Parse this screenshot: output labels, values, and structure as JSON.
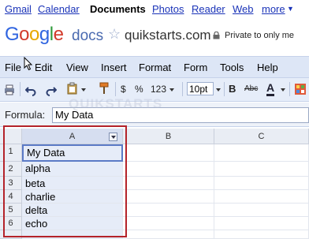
{
  "topnav": {
    "items": [
      "Gmail",
      "Calendar",
      "Documents",
      "Photos",
      "Reader",
      "Web",
      "more"
    ],
    "more_arrow": "▼"
  },
  "header": {
    "logo": "Google",
    "product": "docs",
    "domain": "quikstarts.com",
    "privacy": "Private to only me"
  },
  "menu": [
    "File",
    "Edit",
    "View",
    "Insert",
    "Format",
    "Form",
    "Tools",
    "Help"
  ],
  "toolbar": {
    "currency": "$",
    "percent": "%",
    "number_format": "123",
    "font_size": "10pt",
    "bold": "B",
    "strike": "Abc",
    "text_color": "A"
  },
  "formula": {
    "label": "Formula:",
    "value": "My Data"
  },
  "watermark": "QUIKSTARTS",
  "sheet": {
    "columns": [
      "A",
      "B",
      "C"
    ],
    "rows": [
      "1",
      "2",
      "3",
      "4",
      "5",
      "6"
    ],
    "cells": [
      "My Data",
      "alpha",
      "beta",
      "charlie",
      "delta",
      "echo"
    ]
  },
  "colors": {
    "menubar_bg": "#dde6f6",
    "highlight_frame": "#b4232a",
    "link": "#1a33b8"
  }
}
